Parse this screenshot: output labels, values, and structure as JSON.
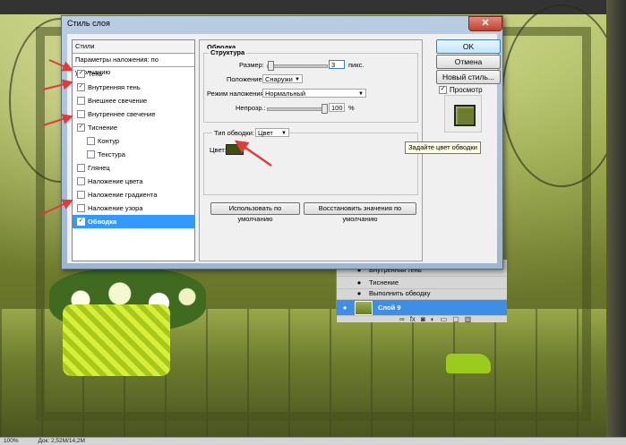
{
  "dialog": {
    "title": "Стиль слоя",
    "left_list": {
      "header": "Стили",
      "subheader": "Параметры наложения: по умолчанию",
      "items": [
        {
          "label": "Тень",
          "checked": true
        },
        {
          "label": "Внутренняя тень",
          "checked": true
        },
        {
          "label": "Внешнее свечение",
          "checked": false
        },
        {
          "label": "Внутреннее свечение",
          "checked": false
        },
        {
          "label": "Тиснение",
          "checked": true
        },
        {
          "label": "Контур",
          "checked": false
        },
        {
          "label": "Текстура",
          "checked": false
        },
        {
          "label": "Глянец",
          "checked": false
        },
        {
          "label": "Наложение цвета",
          "checked": false
        },
        {
          "label": "Наложение градиента",
          "checked": false
        },
        {
          "label": "Наложение узора",
          "checked": false
        },
        {
          "label": "Обводка",
          "checked": true,
          "selected": true
        }
      ]
    },
    "stroke": {
      "title": "Обводка",
      "structure_title": "Структура",
      "size_label": "Размер:",
      "size_value": "3",
      "size_unit": "пикс.",
      "position_label": "Положение:",
      "position_value": "Снаружи",
      "blend_label": "Режим наложения:",
      "blend_value": "Нормальный",
      "opacity_label": "Непрозр.:",
      "opacity_value": "100",
      "opacity_unit": "%",
      "opacity_level": 1.0,
      "fill_type_label": "Тип обводки:",
      "fill_type_value": "Цвет",
      "color_label": "Цвет:",
      "color_hex": "#3e4f12",
      "use_default_button": "Использовать по умолчанию",
      "restore_default_button": "Восстановить значения по умолчанию"
    },
    "buttons": {
      "ok": "OK",
      "cancel": "Отмена",
      "new_style": "Новый стиль...",
      "preview_label": "Просмотр",
      "preview_checked": true
    },
    "tooltip": "Задайте цвет обводки"
  },
  "layers_panel": {
    "rows": [
      {
        "label": "Внутренняя тень"
      },
      {
        "label": "Тиснение"
      },
      {
        "label": "Выполнить обводку"
      }
    ],
    "selected_layer": "Слой 9"
  },
  "status_bar": {
    "zoom": "100%",
    "doc": "Док: 2,52M/14,2M"
  },
  "colors": {
    "accent": "#3399ff",
    "annotation_arrow": "#e03a3a"
  }
}
